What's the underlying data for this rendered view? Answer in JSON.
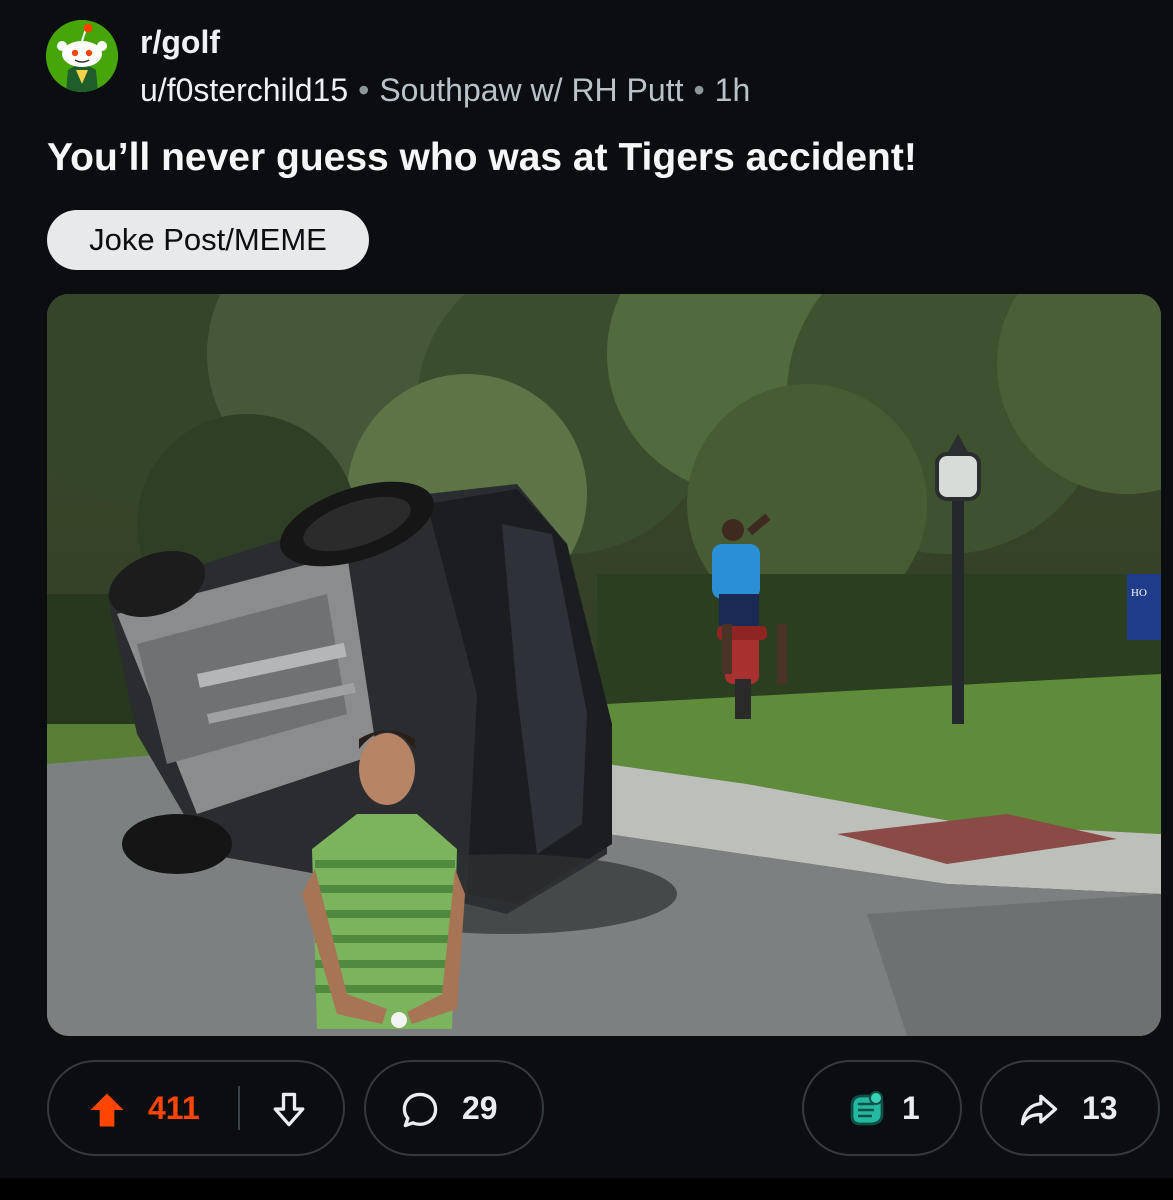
{
  "post": {
    "subreddit": "r/golf",
    "username": "u/f0sterchild15",
    "user_flair": "Southpaw w/ RH Putt",
    "age": "1h",
    "title": "You’ll never guess who was at Tigers accident!",
    "post_flair": "Joke Post/MEME",
    "image_sign_text": "HO"
  },
  "actions": {
    "upvotes": "411",
    "comments": "29",
    "awards": "1",
    "shares": "13"
  },
  "colors": {
    "background": "#0b0d10",
    "upvote_accent": "#ff4500",
    "avatar_green": "#46a508",
    "award_teal": "#22b8a2"
  },
  "icons": {
    "upvote": "arrow-up-icon",
    "downvote": "arrow-down-icon",
    "comment": "speech-bubble-icon",
    "award": "award-hand-icon",
    "share": "share-arrow-icon"
  }
}
